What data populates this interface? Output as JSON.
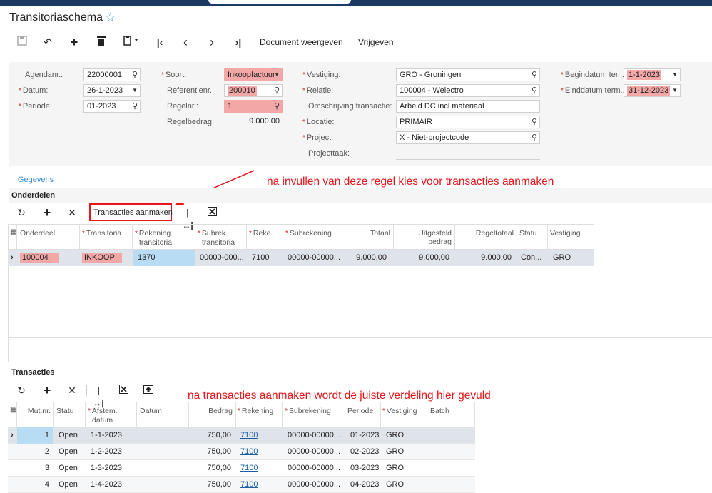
{
  "page": {
    "title": "Transitoriaschema"
  },
  "toolbar": {
    "document_label": "Document weergeven",
    "release_label": "Vrijgeven"
  },
  "form": {
    "agendanr_label": "Agendanr.:",
    "agendanr": "22000001",
    "datum_label": "Datum:",
    "datum": "26-1-2023",
    "periode_label": "Periode:",
    "periode": "01-2023",
    "soort_label": "Soort:",
    "soort": "Inkoopfactuur",
    "referentienr_label": "Referentienr.:",
    "referentienr": "200010",
    "regelnr_label": "Regelnr.:",
    "regelnr": "1",
    "regelbedrag_label": "Regelbedrag:",
    "regelbedrag": "9.000,00",
    "vestiging_label": "Vestiging:",
    "vestiging": "GRO - Groningen",
    "relatie_label": "Relatie:",
    "relatie": "100004 - Welectro",
    "omschrijving_label": "Omschrijving transactie:",
    "omschrijving": "Arbeid DC incl materiaal",
    "locatie_label": "Locatie:",
    "locatie": "PRIMAIR",
    "project_label": "Project:",
    "project": "X - Niet-projectcode",
    "projecttaak_label": "Projecttaak:",
    "begindatum_label": "Begindatum ter...",
    "begindatum": "1-1-2023",
    "einddatum_label": "Einddatum term...",
    "einddatum": "31-12-2023"
  },
  "tabs": [
    {
      "label": "Gegevens"
    }
  ],
  "annotations": {
    "top": "na invullen van deze regel kies voor transacties aanmaken",
    "bottom": "na transacties aanmaken wordt de juiste verdeling hier gevuld"
  },
  "onderdelen": {
    "title": "Onderdelen",
    "create_button": "Transacties aanmaken",
    "headers": {
      "onderdeel": "Onderdeel",
      "transitoria": "Transitoria",
      "rek_trans_1": "Rekening",
      "rek_trans_2": "transitoria",
      "subrek_trans_1": "Subrek.",
      "subrek_trans_2": "transitoria",
      "reke": "Reke",
      "subrekening": "Subrekening",
      "totaal": "Totaal",
      "uitgesteld_1": "Uitgesteld",
      "uitgesteld_2": "bedrag",
      "regeltotaal": "Regeltotaal",
      "statu": "Statu",
      "vestiging": "Vestiging"
    },
    "row": {
      "onderdeel": "100004",
      "transitoria": "INKOOP",
      "rekening_transitoria": "1370",
      "subrek_transitoria": "00000-000...",
      "reke": "7100",
      "subrekening": "00000-00000...",
      "totaal": "9.000,00",
      "uitgesteld": "9.000,00",
      "regeltotaal": "9.000,00",
      "statu": "Con...",
      "vestiging": "GRO"
    }
  },
  "transacties": {
    "title": "Transacties",
    "headers": {
      "mutnr": "Mut.nr.",
      "statu": "Statu",
      "afstem_1": "Afstem.",
      "afstem_2": "datum",
      "datum": "Datum",
      "bedrag": "Bedrag",
      "rekening": "Rekening",
      "subrekening": "Subrekening",
      "periode": "Periode",
      "vestiging": "Vestiging",
      "batch": "Batch"
    },
    "rows": [
      {
        "mutnr": "1",
        "statu": "Open",
        "afstem": "1-1-2023",
        "bedrag": "750,00",
        "rekening": "7100",
        "subrekening": "00000-00000...",
        "periode": "01-2023",
        "vestiging": "GRO"
      },
      {
        "mutnr": "2",
        "statu": "Open",
        "afstem": "1-2-2023",
        "bedrag": "750,00",
        "rekening": "7100",
        "subrekening": "00000-00000...",
        "periode": "02-2023",
        "vestiging": "GRO"
      },
      {
        "mutnr": "3",
        "statu": "Open",
        "afstem": "1-3-2023",
        "bedrag": "750,00",
        "rekening": "7100",
        "subrekening": "00000-00000...",
        "periode": "03-2023",
        "vestiging": "GRO"
      },
      {
        "mutnr": "4",
        "statu": "Open",
        "afstem": "1-4-2023",
        "bedrag": "750,00",
        "rekening": "7100",
        "subrekening": "00000-00000...",
        "periode": "04-2023",
        "vestiging": "GRO"
      }
    ]
  },
  "colors": {
    "accent": "#3b8fd9",
    "highlight": "#f3a7a7",
    "annotation": "#e8151b",
    "selected_row": "#dfe3ea",
    "selected_cell": "#b9dcf5"
  }
}
